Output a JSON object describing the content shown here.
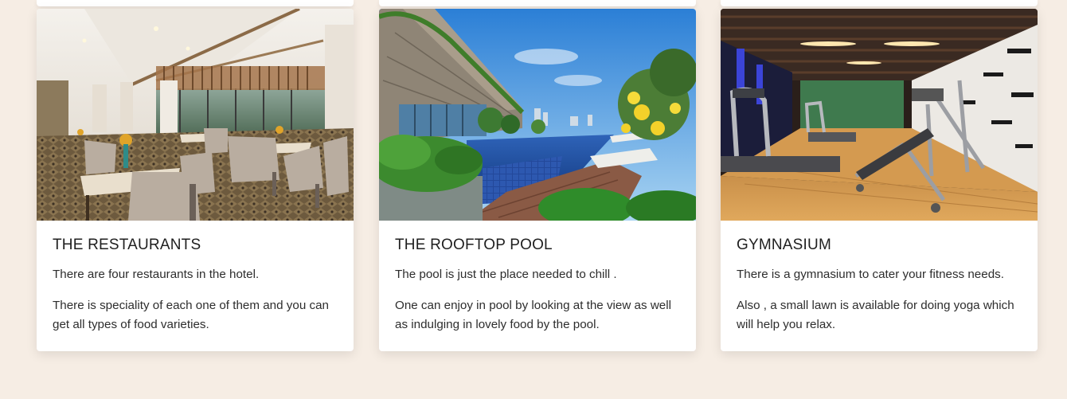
{
  "cards": [
    {
      "title": "THE RESTAURANTS",
      "image_subject": "hotel restaurant dining room",
      "line1": "There are four restaurants in the hotel.",
      "line2": "There is speciality of each one of them and you can get all types of food varieties."
    },
    {
      "title": "THE ROOFTOP POOL",
      "image_subject": "rooftop infinity pool with city view",
      "line1": "The pool is just the place needed to chill .",
      "line2": "One can enjoy in pool by looking at the view as well as indulging in lovely food by the pool."
    },
    {
      "title": "GYMNASIUM",
      "image_subject": "gym with treadmills and weight bench",
      "line1": "There is a gymnasium to cater your fitness needs.",
      "line2": "Also , a small lawn is available for doing yoga which will help you relax."
    }
  ],
  "colors": {
    "page_background": "#f6ede4",
    "card_background": "#ffffff",
    "text": "#2d2d2d"
  }
}
